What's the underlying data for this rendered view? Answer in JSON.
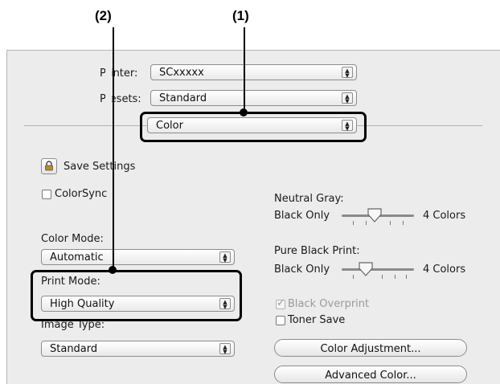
{
  "callouts": {
    "one": "(1)",
    "two": "(2)"
  },
  "printer": {
    "label": "Printer:",
    "value": "SCxxxxx"
  },
  "presets": {
    "label": "Presets:",
    "value": "Standard"
  },
  "panel_select": {
    "value": "Color"
  },
  "save_settings": {
    "label": "Save Settings"
  },
  "colorsync": {
    "label": "ColorSync"
  },
  "color_mode": {
    "label": "Color Mode:",
    "value": "Automatic"
  },
  "print_mode": {
    "label": "Print Mode:",
    "value": "High Quality"
  },
  "image_type": {
    "label": "Image Type:",
    "value": "Standard"
  },
  "neutral_gray": {
    "label": "Neutral Gray:",
    "min_label": "Black Only",
    "max_label": "4 Colors",
    "level": 0.45
  },
  "pure_black": {
    "label": "Pure Black Print:",
    "min_label": "Black Only",
    "max_label": "4 Colors",
    "level": 0.33
  },
  "black_overprint": {
    "label": "Black Overprint",
    "checked": true,
    "enabled": false
  },
  "toner_save": {
    "label": "Toner Save",
    "checked": false
  },
  "buttons": {
    "color_adjustment": "Color Adjustment...",
    "advanced_color": "Advanced Color..."
  },
  "icons": {
    "lock": "lock-icon",
    "popup": "up-down-arrows-icon",
    "slider_thumb": "slider-thumb-icon",
    "check": "checkmark-icon"
  }
}
